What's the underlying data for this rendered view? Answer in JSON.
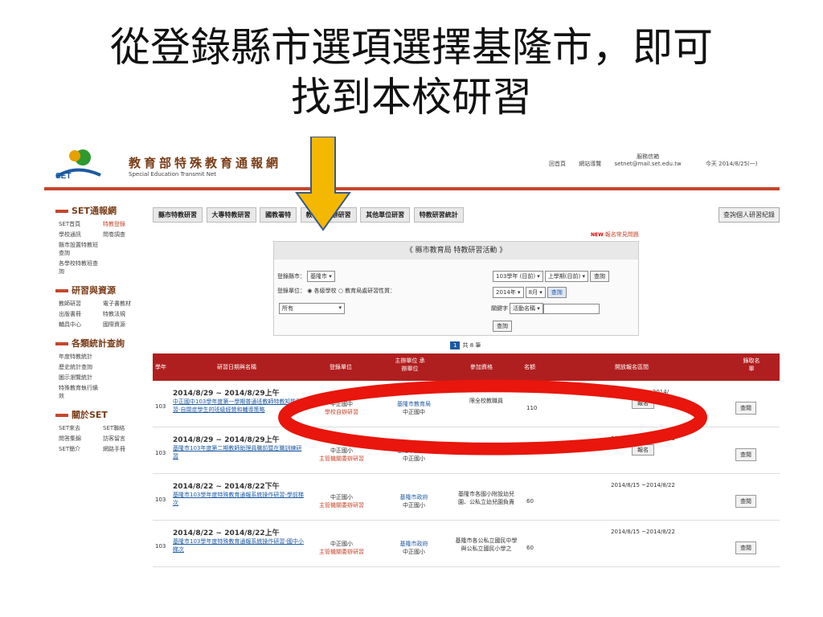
{
  "slide_title_line1": "從登錄縣市選項選擇基隆市，即可",
  "slide_title_line2": "找到本校研習",
  "header": {
    "brand": "教育部特殊教育通報網",
    "brand_en": "Special Education Transmit Net",
    "nav": [
      "回首頁",
      "網站導覽",
      "服務信箱",
      "setnet@mail.set.edu.tw",
      "今天 2014/8/25(一)"
    ]
  },
  "sidebar": {
    "sections": [
      {
        "title": "SET通報網",
        "links": [
          "SET首頁",
          "特教登錄",
          "學校通訊",
          "問卷調查",
          "縣市設置特教班查詢",
          "",
          "各學校特教班查詢",
          ""
        ]
      },
      {
        "title": "研習與資源",
        "links": [
          "教師研習",
          "電子書教材",
          "出版書冊",
          "特教法規",
          "輔具中心",
          "國際資源"
        ]
      },
      {
        "title": "各類統計查詢",
        "links": [
          "年度特教統計",
          "",
          "歷史統計查詢",
          "",
          "圖示瀏覽統計",
          "",
          "特殊教育執行績效",
          ""
        ]
      },
      {
        "title": "關於SET",
        "links": [
          "SET來去",
          "SET聯絡",
          "問答集錦",
          "訪客留言",
          "SET簡介",
          "網路手冊"
        ]
      }
    ]
  },
  "tabs": [
    "縣市特教研習",
    "大專特教研習",
    "國教署特",
    "教育部委辦研習",
    "其他單位研習",
    "特教研習統計"
  ],
  "record_button": "查詢個人研習紀錄",
  "reg_question": {
    "new": "NEW",
    "label": "報名常見問題"
  },
  "panel": {
    "header": "《 縣市教育局 特教研習活動 》",
    "county_label": "登錄縣市：",
    "county_value": "基隆市",
    "unit_label": "登錄單位：",
    "unit_opt1": "各級學校",
    "unit_opt2": "教育局處研習性質：",
    "all_value": "所有",
    "year_value": "103學年 (目前)",
    "term_value": "上學期(目前)",
    "query": "查詢",
    "year2_value": "2014年",
    "month_value": "8月",
    "keyword_label": "關鍵字",
    "keyword_field": "活動名稱"
  },
  "pager": {
    "current": "1",
    "total": "共 8 筆"
  },
  "table": {
    "headers": [
      "學年",
      "研習日期與名稱",
      "登錄單位",
      "主辦單位 承辦單位",
      "參加資格",
      "名額",
      "開放報名區間",
      "錄取名單"
    ],
    "rows": [
      {
        "year": "103",
        "date": "2014/8/29 ~ 2014/8/29上午",
        "title": "中正國中103學年度第一學期普通班教師特教知能研習-自閉症學生的班級經營和輔導策略",
        "unit": "中正國中",
        "unit_sub": "學校自辦研習",
        "org": "基隆市教育局",
        "org2": "中正國中",
        "qual": "限全校教職員",
        "count": "110",
        "period": "2014/8/25 ~2014/",
        "reg": "報名",
        "view": "查閱"
      },
      {
        "year": "103",
        "date": "2014/8/29 ~ 2014/8/29上午",
        "title": "基隆市103年度第二期教師助理員職前暨在職訓練研習",
        "unit": "中正國小",
        "unit_sub": "主管機關委辦研習",
        "org": "基隆市教育局",
        "org2": "中正國小",
        "qual": "本市專兼任教師助理員",
        "count": "",
        "period": "2014/8/20 ~2014/8/29",
        "reg": "報名",
        "view": "查閱"
      },
      {
        "year": "103",
        "date": "2014/8/22 ~ 2014/8/22下午",
        "title": "基隆市103學年度特殊教育通報系統操作研習-學前梯次",
        "unit": "中正國小",
        "unit_sub": "主管機關委辦研習",
        "org": "基隆市政府",
        "org2": "中正國小",
        "qual": "基隆市各國小附設幼兒園、公私立幼兒園負責",
        "count": "60",
        "period": "2014/8/15 ~2014/8/22",
        "reg": "",
        "view": "查閱"
      },
      {
        "year": "103",
        "date": "2014/8/22 ~ 2014/8/22上午",
        "title": "基隆市103學年度特殊教育通報系統操作研習-國中小梯次",
        "unit": "中正國小",
        "unit_sub": "主管機關委辦研習",
        "org": "基隆市政府",
        "org2": "中正國小",
        "qual": "基隆市各公私立國民中學與公私立國民小學之",
        "count": "60",
        "period": "2014/8/15 ~2014/8/22",
        "reg": "",
        "view": "查閱"
      }
    ]
  },
  "colors": {
    "accent_red": "#c6462c",
    "header_red": "#b01f1f",
    "arrow_yellow": "#f5b800",
    "oval_red": "#e8160c"
  }
}
